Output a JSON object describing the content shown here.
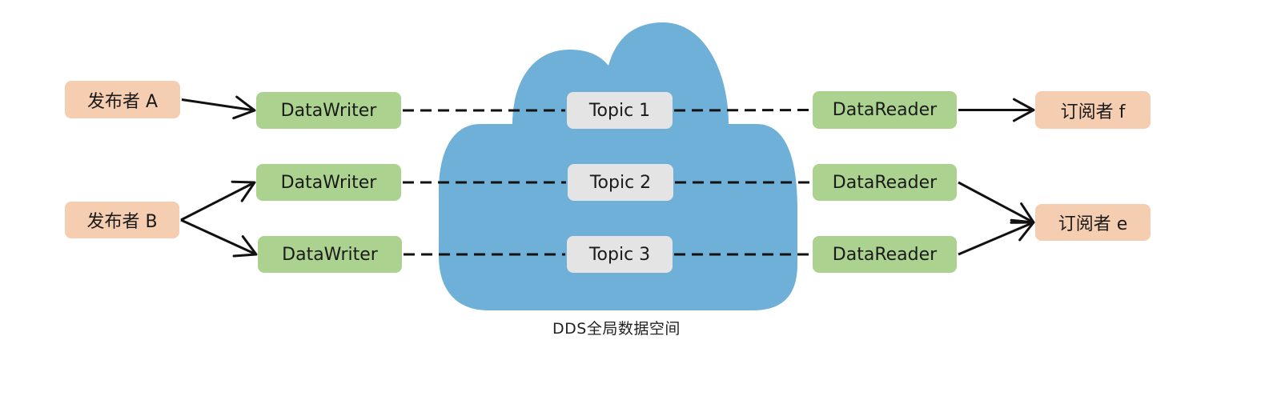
{
  "diagram": {
    "title": "DDS全局数据空间",
    "colors": {
      "publisher_fill": "#f5cdb0",
      "endpoint_fill": "#abd38f",
      "topic_fill": "#e4e4e4",
      "cloud_fill": "#6eb0d8",
      "line": "#111111"
    },
    "publishers": [
      {
        "id": "pubA",
        "label": "发布者 A"
      },
      {
        "id": "pubB",
        "label": "发布者 B"
      }
    ],
    "writers": [
      {
        "id": "w1",
        "label": "DataWriter",
        "topic": "t1"
      },
      {
        "id": "w2",
        "label": "DataWriter",
        "topic": "t2"
      },
      {
        "id": "w3",
        "label": "DataWriter",
        "topic": "t3"
      }
    ],
    "topics": [
      {
        "id": "t1",
        "label": "Topic 1"
      },
      {
        "id": "t2",
        "label": "Topic 2"
      },
      {
        "id": "t3",
        "label": "Topic 3"
      }
    ],
    "readers": [
      {
        "id": "r1",
        "label": "DataReader",
        "topic": "t1"
      },
      {
        "id": "r2",
        "label": "DataReader",
        "topic": "t2"
      },
      {
        "id": "r3",
        "label": "DataReader",
        "topic": "t3"
      }
    ],
    "subscribers": [
      {
        "id": "subF",
        "label": "订阅者 f"
      },
      {
        "id": "subE",
        "label": "订阅者 e"
      }
    ],
    "edges": [
      {
        "from": "pubA",
        "to": "w1",
        "style": "arrow"
      },
      {
        "from": "pubB",
        "to": "w2",
        "style": "arrow"
      },
      {
        "from": "pubB",
        "to": "w3",
        "style": "arrow"
      },
      {
        "from": "w1",
        "to": "t1",
        "style": "dashed"
      },
      {
        "from": "w2",
        "to": "t2",
        "style": "dashed"
      },
      {
        "from": "w3",
        "to": "t3",
        "style": "dashed"
      },
      {
        "from": "t1",
        "to": "r1",
        "style": "dashed"
      },
      {
        "from": "t2",
        "to": "r2",
        "style": "dashed"
      },
      {
        "from": "t3",
        "to": "r3",
        "style": "dashed"
      },
      {
        "from": "r1",
        "to": "subF",
        "style": "arrow"
      },
      {
        "from": "r2",
        "to": "subE",
        "style": "arrow"
      },
      {
        "from": "r3",
        "to": "subE",
        "style": "arrow"
      }
    ]
  }
}
